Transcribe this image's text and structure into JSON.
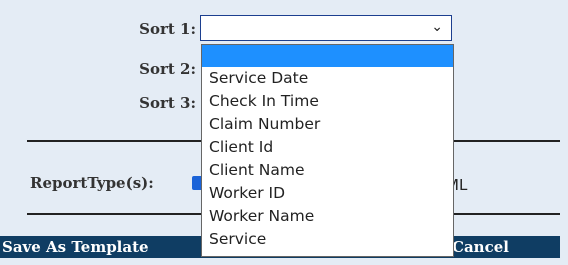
{
  "sort": {
    "sort1_label": "Sort 1:",
    "sort2_label": "Sort 2:",
    "sort3_label": "Sort 3:",
    "sort1_value": ""
  },
  "report": {
    "types_label": "ReportType(s):",
    "obscured_option_text": "ML"
  },
  "bottom_bar": {
    "save_template": "Save As Template",
    "cancel": "Cancel"
  },
  "dropdown": {
    "options": [
      "",
      "Service Date",
      "Check In Time",
      "Claim Number",
      "Client Id",
      "Client Name",
      "Worker ID",
      "Worker Name",
      "Service"
    ]
  },
  "colors": {
    "page_bg": "#e4ecf5",
    "bar_bg": "#0f3d63",
    "selected_option": "#1e90ff",
    "checkbox_blue": "#1a63d8"
  },
  "icons": {
    "select_chevron": "chevron-down-icon"
  }
}
